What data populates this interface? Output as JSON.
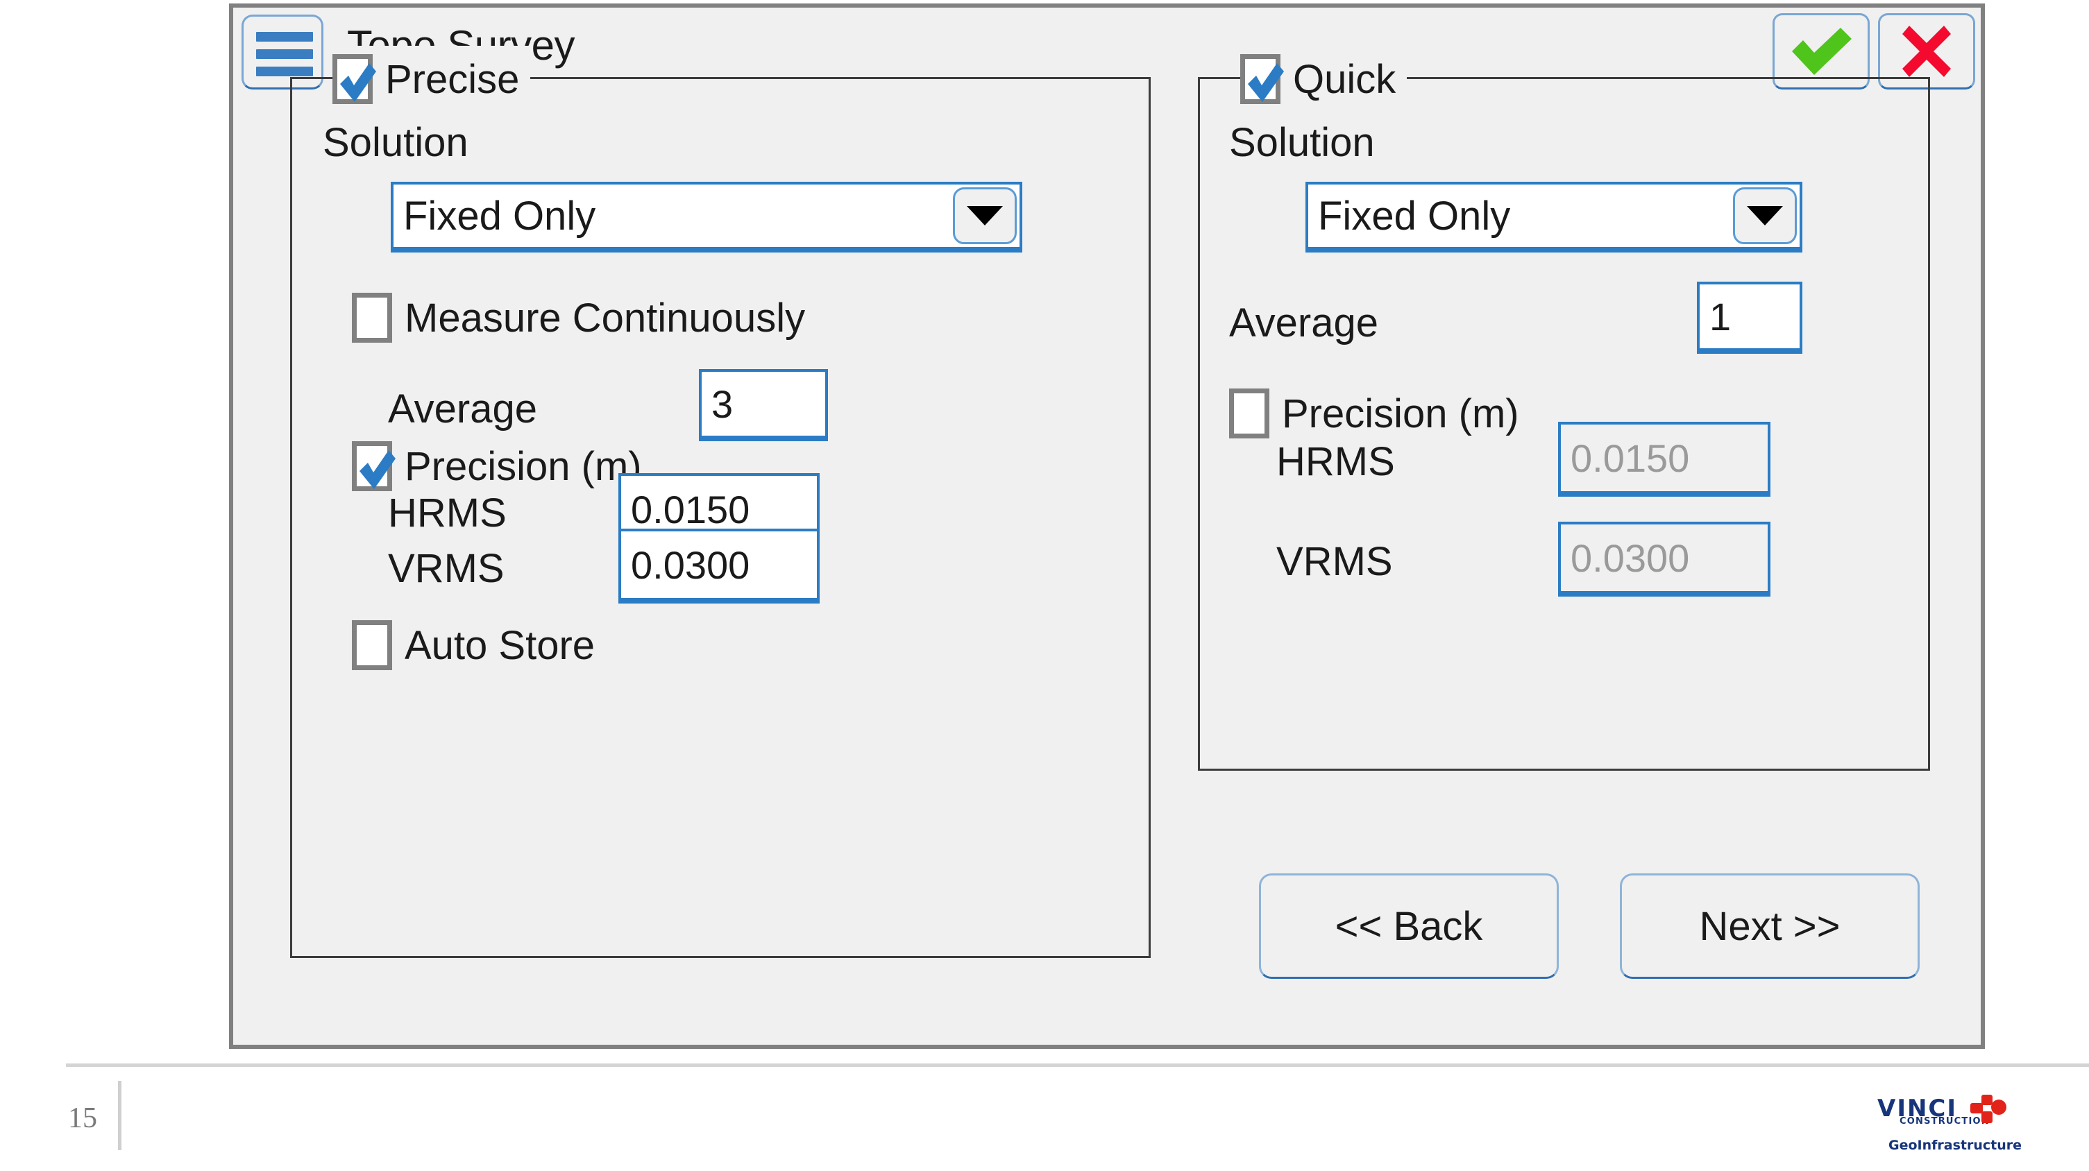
{
  "window": {
    "title": "Topo Survey",
    "menu_icon": "hamburger-menu-icon",
    "confirm_icon": "green-check-icon",
    "cancel_icon": "red-x-icon"
  },
  "precise": {
    "caption": "Precise",
    "checked": true,
    "solution_label": "Solution",
    "solution_value": "Fixed Only",
    "measure_continuously_label": "Measure Continuously",
    "measure_continuously_checked": false,
    "average_label": "Average",
    "average_value": "3",
    "precision_label": "Precision (m)",
    "precision_checked": true,
    "hrms_label": "HRMS",
    "hrms_value": "0.0150",
    "vrms_label": "VRMS",
    "vrms_value": "0.0300",
    "auto_store_label": "Auto Store",
    "auto_store_checked": false
  },
  "quick": {
    "caption": "Quick",
    "checked": true,
    "solution_label": "Solution",
    "solution_value": "Fixed Only",
    "average_label": "Average",
    "average_value": "1",
    "precision_label": "Precision (m)",
    "precision_checked": false,
    "hrms_label": "HRMS",
    "hrms_value": "0.0150",
    "vrms_label": "VRMS",
    "vrms_value": "0.0300"
  },
  "nav": {
    "back_label": "<< Back",
    "next_label": "Next >>"
  },
  "footer": {
    "page_number": "15",
    "logo_wordmark": "VINCI",
    "logo_sub": "CONSTRUCTION",
    "logo_tagline": "GeoInfrastructure"
  },
  "colors": {
    "accent_blue": "#2b7cc4",
    "check_blue": "#2b7cc4",
    "ok_green": "#4fc41a",
    "cancel_red": "#f40a2e",
    "window_border": "#808080",
    "window_bg": "#f0f0f0",
    "logo_navy": "#17357a",
    "logo_red": "#e2231a"
  }
}
